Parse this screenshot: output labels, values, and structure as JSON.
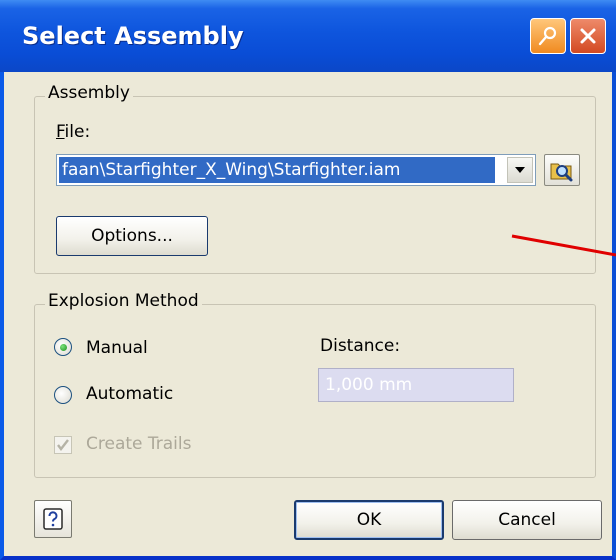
{
  "window": {
    "title": "Select Assembly",
    "accent_color": "#0a4dd6",
    "pin_icon": "pin-icon",
    "close_icon": "close-icon"
  },
  "assembly_group": {
    "legend": "Assembly",
    "file_label_accel": "F",
    "file_label_rest": "ile:",
    "file_value": "faan\\Starfighter_X_Wing\\Starfighter.iam",
    "dropdown_icon": "chevron-down-icon",
    "browse_icon": "browse-folder-icon",
    "options_button": "Options..."
  },
  "explosion_group": {
    "legend": "Explosion Method",
    "manual_label": "Manual",
    "manual_selected": true,
    "automatic_label": "Automatic",
    "automatic_selected": false,
    "distance_label": "Distance:",
    "distance_value": "1,000 mm",
    "create_trails_label": "Create Trails",
    "create_trails_checked": true
  },
  "footer": {
    "help_icon": "help-icon",
    "ok_label": "OK",
    "cancel_label": "Cancel"
  },
  "annotation": {
    "color": "#e00000"
  }
}
